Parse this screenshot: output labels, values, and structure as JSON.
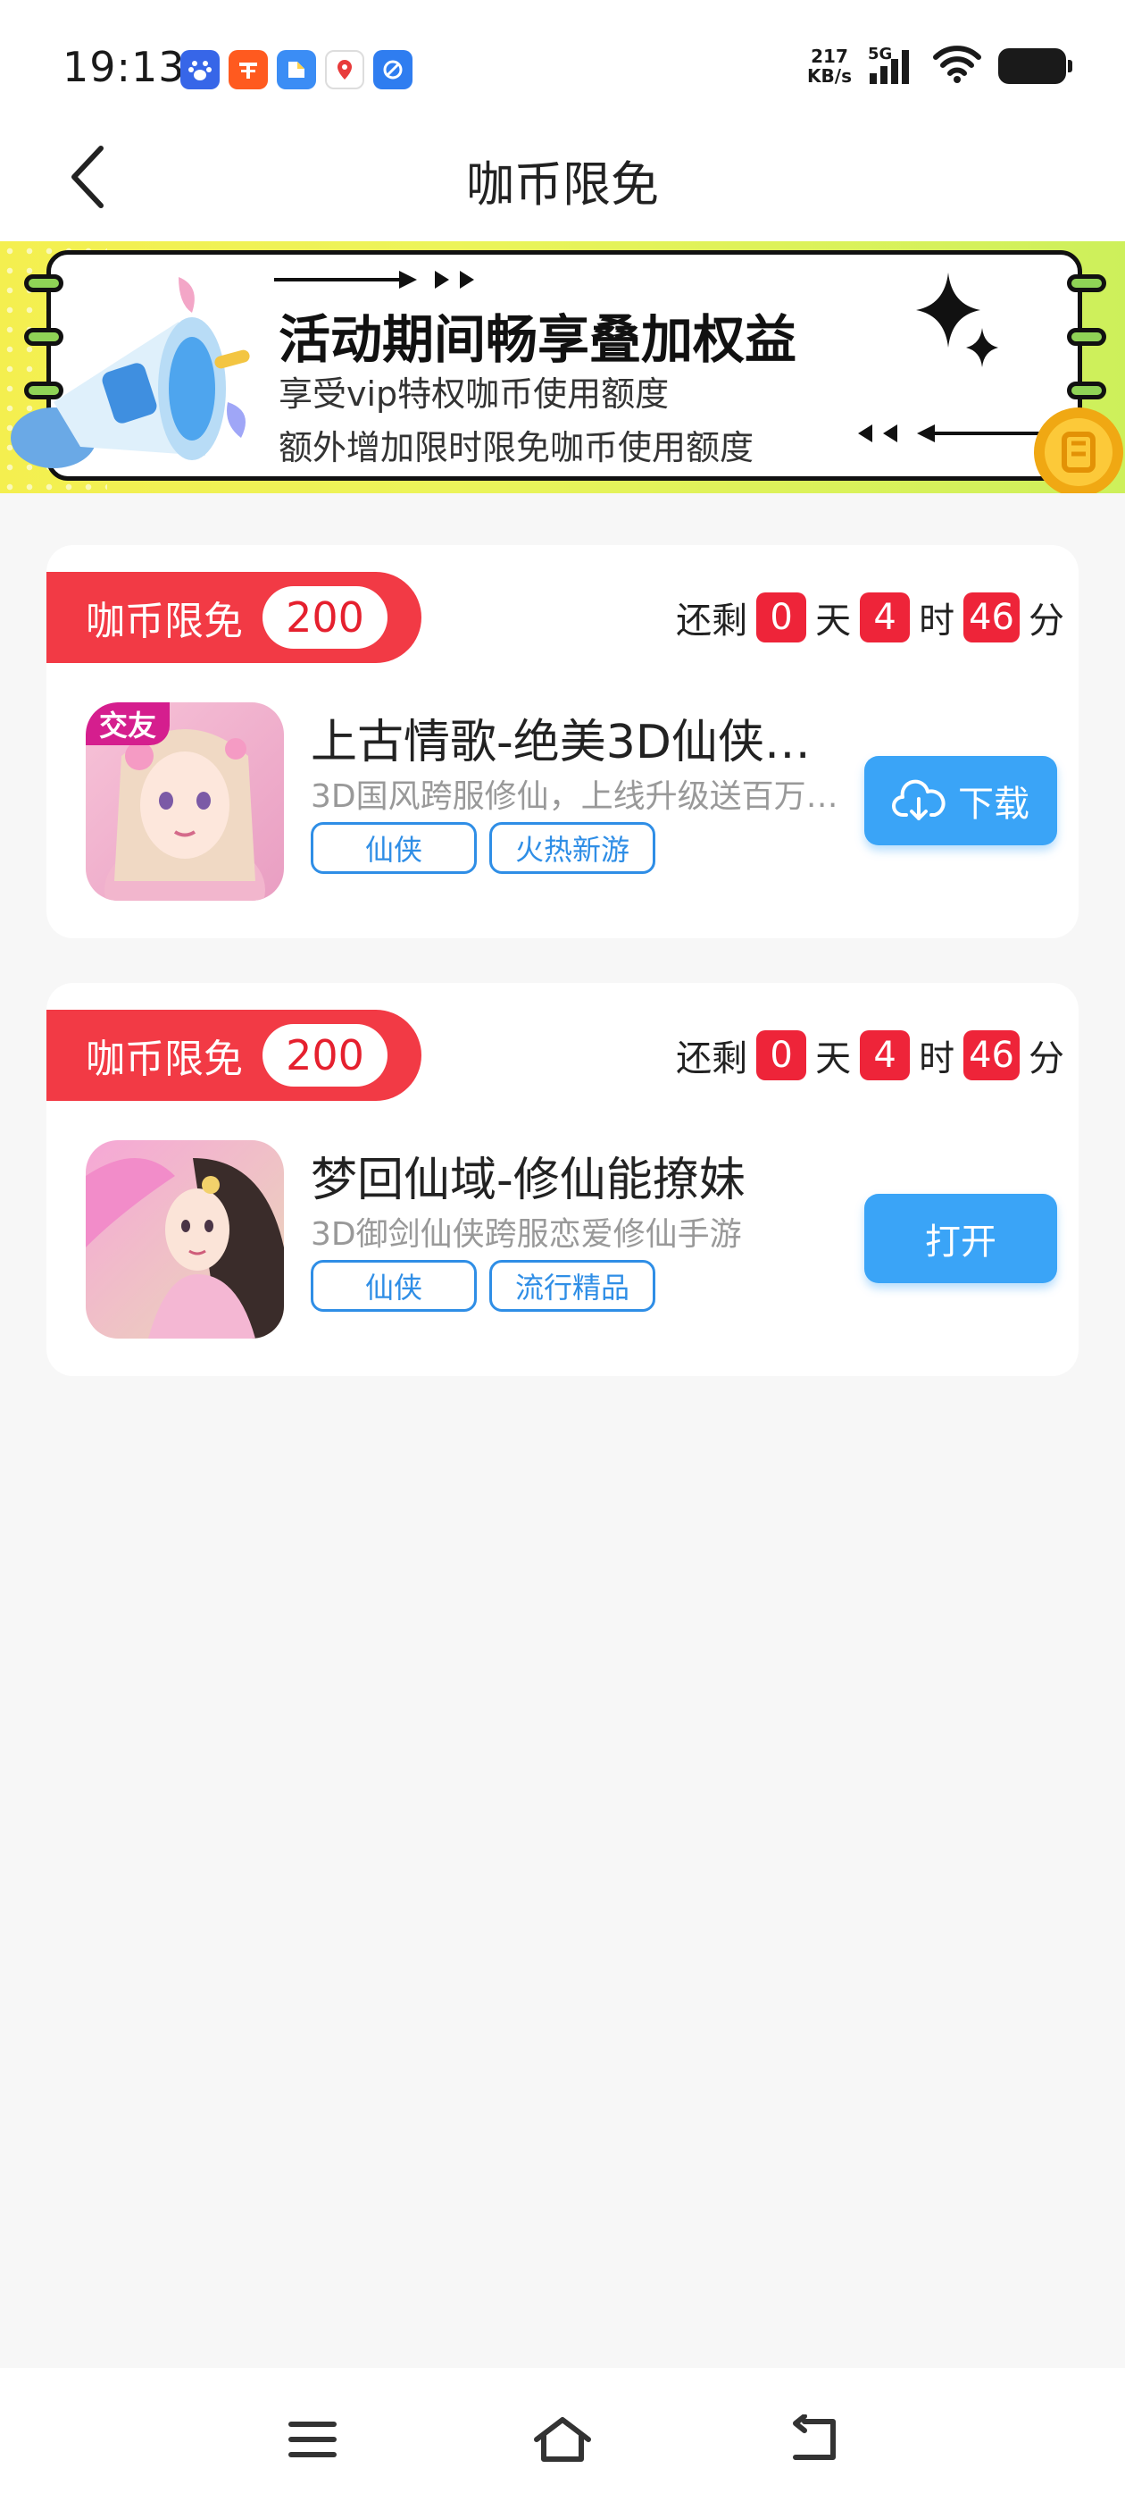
{
  "status_bar": {
    "time": "19:13",
    "net_speed_value": "217",
    "net_speed_unit": "KB/s",
    "network": "5G",
    "app_icons": [
      "baidu-icon",
      "taobao-icon",
      "files-icon",
      "map-icon",
      "browser-icon"
    ]
  },
  "header": {
    "title": "咖币限免"
  },
  "banner": {
    "heading": "活动期间畅享叠加权益",
    "line1": "享受vip特权咖币使用额度",
    "line2": "额外增加限时限免咖币使用额度"
  },
  "promotions": [
    {
      "tag_label": "咖币限免",
      "tag_value": "200",
      "countdown": {
        "prefix": "还剩",
        "days": "0",
        "days_unit": "天",
        "hours": "4",
        "hours_unit": "时",
        "minutes": "46",
        "minutes_unit": "分"
      },
      "icon_badge": "交友",
      "title": "上古情歌-绝美3D仙侠…",
      "description": "3D国风跨服修仙，上线升级送百万…",
      "tags": [
        "仙侠",
        "火热新游"
      ],
      "action": "下载"
    },
    {
      "tag_label": "咖币限免",
      "tag_value": "200",
      "countdown": {
        "prefix": "还剩",
        "days": "0",
        "days_unit": "天",
        "hours": "4",
        "hours_unit": "时",
        "minutes": "46",
        "minutes_unit": "分"
      },
      "title": "梦回仙域-修仙能撩妹",
      "description": "3D御剑仙侠跨服恋爱修仙手游",
      "tags": [
        "仙侠",
        "流行精品"
      ],
      "action": "打开"
    }
  ],
  "colors": {
    "accent_red": "#f23a45",
    "button_blue": "#3aa4f7",
    "tag_blue": "#2f8ee6"
  }
}
